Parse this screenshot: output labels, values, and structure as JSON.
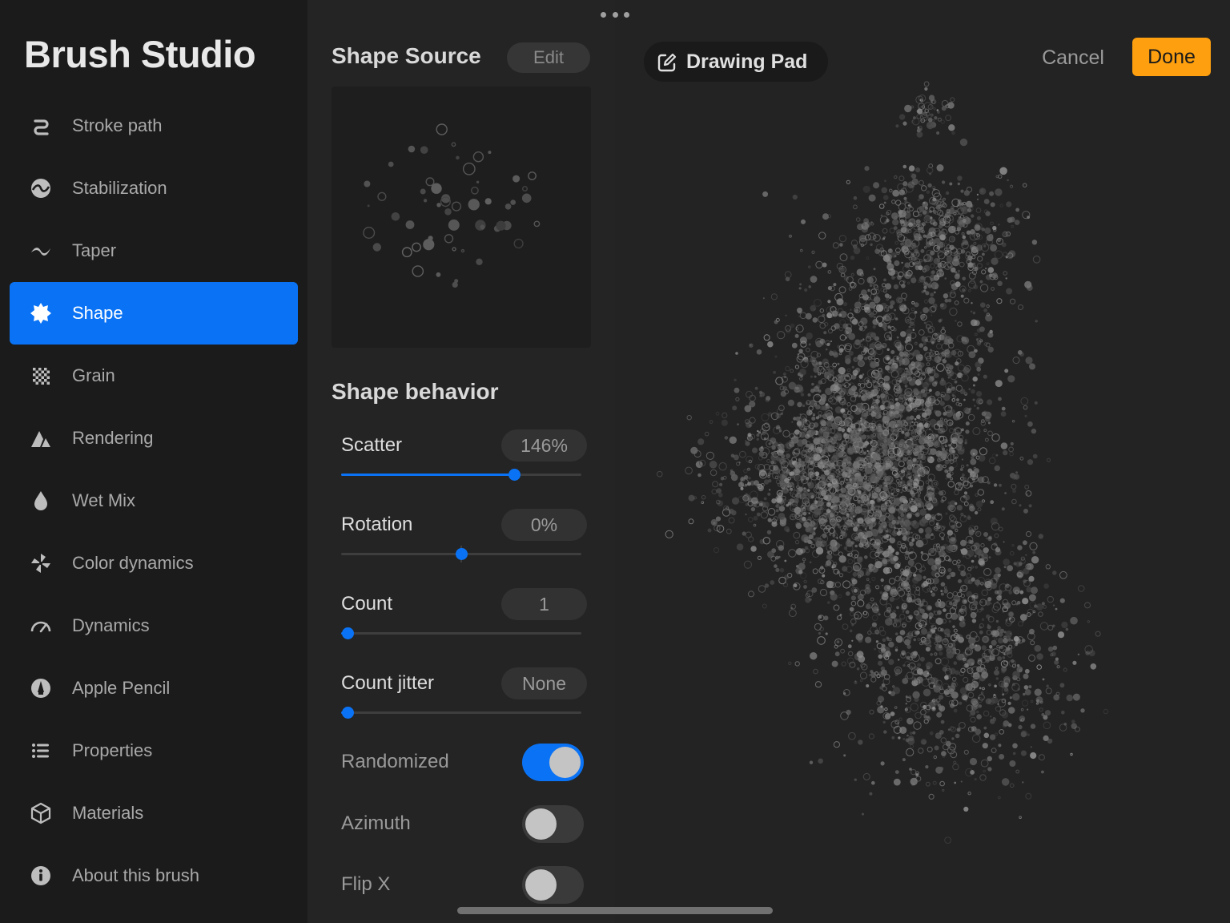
{
  "app": {
    "title": "Brush Studio"
  },
  "sidebar": {
    "items": [
      {
        "label": "Stroke path",
        "icon": "stroke-path-icon",
        "active": false
      },
      {
        "label": "Stabilization",
        "icon": "stabilization-icon",
        "active": false
      },
      {
        "label": "Taper",
        "icon": "taper-icon",
        "active": false
      },
      {
        "label": "Shape",
        "icon": "shape-icon",
        "active": true
      },
      {
        "label": "Grain",
        "icon": "grain-icon",
        "active": false
      },
      {
        "label": "Rendering",
        "icon": "rendering-icon",
        "active": false
      },
      {
        "label": "Wet Mix",
        "icon": "wet-mix-icon",
        "active": false
      },
      {
        "label": "Color dynamics",
        "icon": "color-dynamics-icon",
        "active": false
      },
      {
        "label": "Dynamics",
        "icon": "dynamics-icon",
        "active": false
      },
      {
        "label": "Apple Pencil",
        "icon": "apple-pencil-icon",
        "active": false
      },
      {
        "label": "Properties",
        "icon": "properties-icon",
        "active": false
      },
      {
        "label": "Materials",
        "icon": "materials-icon",
        "active": false
      },
      {
        "label": "About this brush",
        "icon": "info-icon",
        "active": false
      }
    ]
  },
  "panel": {
    "shape_source_title": "Shape Source",
    "edit_label": "Edit",
    "shape_behavior_title": "Shape behavior",
    "sliders": [
      {
        "label": "Scatter",
        "value": "146%",
        "fraction": 0.72,
        "centered": false
      },
      {
        "label": "Rotation",
        "value": "0%",
        "fraction": 0.5,
        "centered": true
      },
      {
        "label": "Count",
        "value": "1",
        "fraction": 0.025,
        "centered": false
      },
      {
        "label": "Count jitter",
        "value": "None",
        "fraction": 0.025,
        "centered": false
      }
    ],
    "toggles": [
      {
        "label": "Randomized",
        "on": true
      },
      {
        "label": "Azimuth",
        "on": false
      },
      {
        "label": "Flip X",
        "on": false
      }
    ]
  },
  "toolbar": {
    "drawing_pad_label": "Drawing Pad",
    "cancel_label": "Cancel",
    "done_label": "Done"
  },
  "colors": {
    "accent": "#0a73f5",
    "done": "#fd9f0e",
    "background": "#1b1b1b",
    "panel": "#242424"
  }
}
